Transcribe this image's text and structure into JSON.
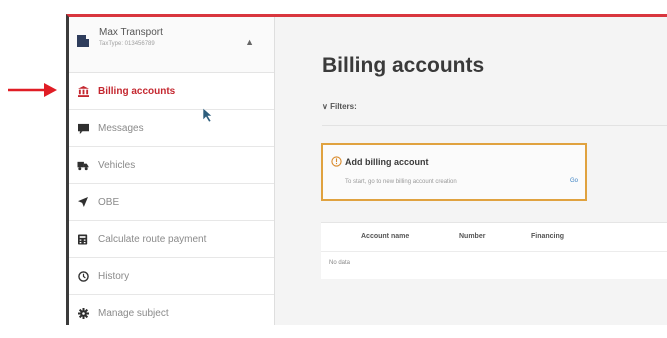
{
  "sidebar": {
    "account": {
      "name": "Max Transport",
      "subtitle": "TaxType: 013456789"
    },
    "items": [
      {
        "label": "Billing accounts",
        "icon": "bank-icon",
        "active": true
      },
      {
        "label": "Messages",
        "icon": "message-icon"
      },
      {
        "label": "Vehicles",
        "icon": "truck-icon"
      },
      {
        "label": "OBE",
        "icon": "location-arrow-icon"
      },
      {
        "label": "Calculate route payment",
        "icon": "calculator-icon"
      },
      {
        "label": "History",
        "icon": "history-icon"
      },
      {
        "label": "Manage subject",
        "icon": "gear-icon"
      }
    ]
  },
  "main": {
    "title": "Billing accounts",
    "filters_label": "Filters:",
    "card": {
      "title": "Add billing account",
      "description": "To start, go to new billing account creation",
      "link": "Go"
    },
    "table": {
      "columns": [
        "Account name",
        "Number",
        "Financing"
      ],
      "empty_text": "No data"
    }
  },
  "colors": {
    "accent": "#c4272f",
    "card_border": "#e0a23f",
    "frame_top": "#d9363e"
  }
}
